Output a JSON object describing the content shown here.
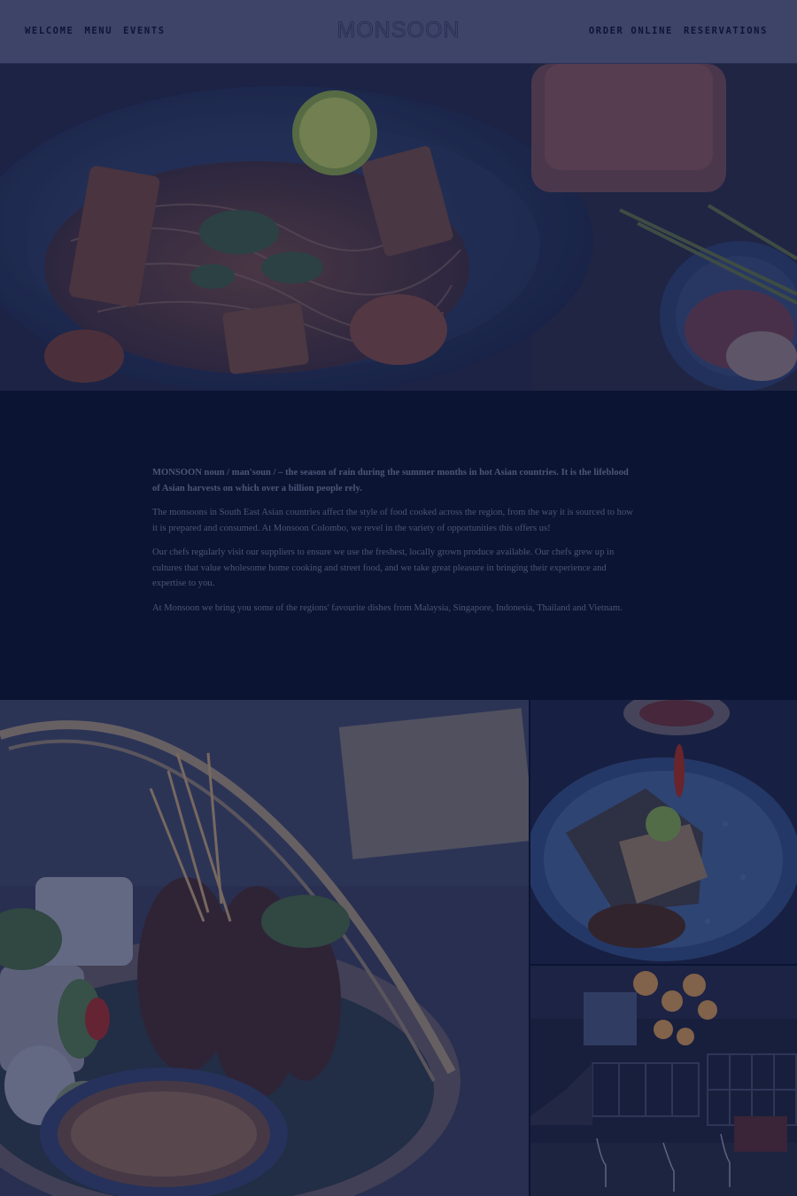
{
  "header": {
    "nav_left": [
      "WELCOME",
      "MENU",
      "EVENTS"
    ],
    "logo": "MONSOON",
    "nav_right": [
      "ORDER ONLINE",
      "RESERVATIONS"
    ]
  },
  "intro": {
    "paragraphs": [
      "MONSOON noun / man'soun / – the season of rain during the summer months in hot Asian countries. It is the lifeblood of Asian harvests on which over a billion people rely.",
      "The monsoons in South East Asian countries affect the style of food cooked across the region, from the way it is sourced to how it is prepared and consumed. At Monsoon Colombo, we revel in the variety of opportunities this offers us!",
      "Our chefs regularly visit our suppliers to ensure we use the freshest, locally grown produce available. Our chefs grew up in cultures that value wholesome home cooking and street food, and we take great pleasure in bringing their experience and expertise to you.",
      "At Monsoon we bring you some of the regions' favourite dishes from Malaysia, Singapore, Indonesia, Thailand and Vietnam."
    ]
  },
  "colors": {
    "header_bg": "#3e4468",
    "page_bg": "#0c1433",
    "text": "#4e5578"
  }
}
